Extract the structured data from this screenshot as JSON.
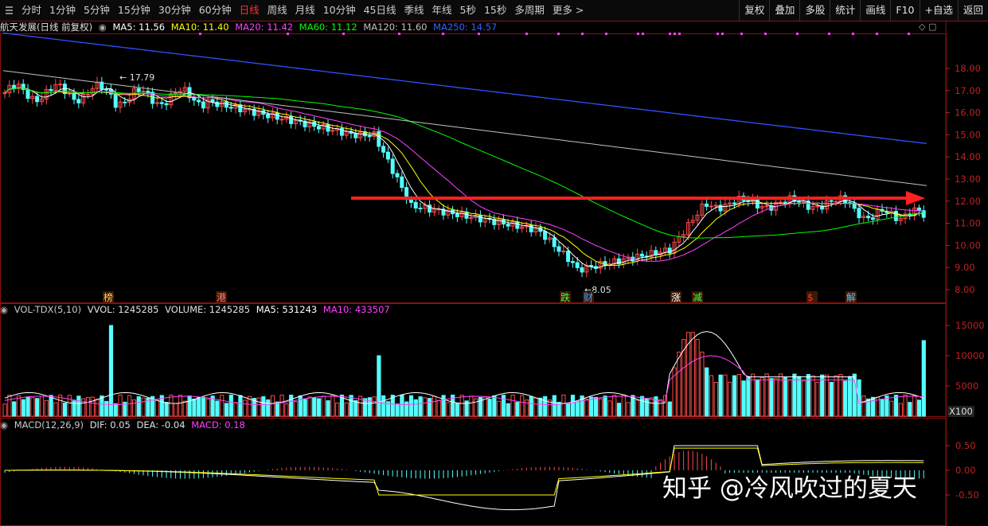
{
  "toolbar": {
    "periods": [
      "分时",
      "1分钟",
      "5分钟",
      "15分钟",
      "30分钟",
      "60分钟",
      "日线",
      "周线",
      "月线",
      "10分钟",
      "45日线",
      "季线",
      "年线",
      "5秒",
      "15秒",
      "多周期",
      "更多 >"
    ],
    "active_period": "日线",
    "buttons": [
      "复权",
      "叠加",
      "多股",
      "统计",
      "画线",
      "F10",
      "+自选",
      "返回"
    ]
  },
  "kline_header": {
    "stock": "航天发展(日线 前复权)",
    "ma5": "MA5: 11.56",
    "ma10": "MA10: 11.40",
    "ma20": "MA20: 11.42",
    "ma60": "MA60: 11.12",
    "ma120": "MA120: 11.60",
    "ma250": "MA250: 14.57"
  },
  "vol_header": {
    "name": "VOL-TDX(5,10)",
    "vvol": "VVOL: 1245285",
    "volume": "VOLUME: 1245285",
    "ma5": "MA5: 531243",
    "ma10": "MA10: 433507"
  },
  "macd_header": {
    "name": "MACD(12,26,9)",
    "dif": "DIF: 0.05",
    "dea": "DEA: -0.04",
    "macd": "MACD: 0.18"
  },
  "price_axis": [
    "18.00",
    "17.00",
    "16.00",
    "15.00",
    "14.00",
    "13.00",
    "12.00",
    "11.00",
    "10.00",
    "9.00",
    "8.00"
  ],
  "vol_axis": [
    "15000",
    "10000",
    "5000"
  ],
  "vol_unit": "X100",
  "macd_axis": [
    "0.50",
    "0.00",
    "-0.50"
  ],
  "annotations": {
    "high": "17.79",
    "low": "8.05"
  },
  "event_markers": [
    "榜",
    "港",
    "跌",
    "财",
    "涨",
    "减",
    "$",
    "解"
  ],
  "watermark": "知乎 @冷风吹过的夏天",
  "colors": {
    "up": "#ff4a4a",
    "down": "#54ffff",
    "ma5": "#ffffff",
    "ma10": "#ffff00",
    "ma20": "#ff40ff",
    "ma60": "#00ff00",
    "ma120": "#c0c0c0",
    "ma250": "#3050ff",
    "accent_line": "#ff2020"
  }
}
